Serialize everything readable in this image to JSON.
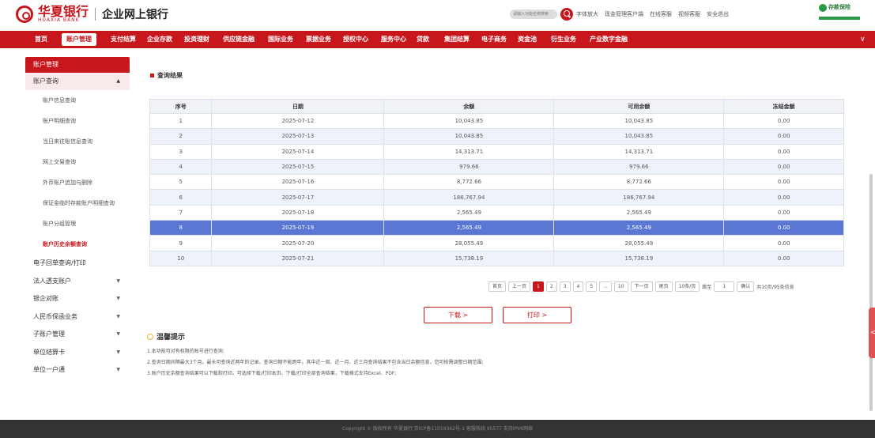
{
  "brand": {
    "name_cn": "华夏银行",
    "name_en": "HUAXIA BANK",
    "sub": "企业网上银行"
  },
  "header": {
    "search_placeholder": "请输入功能名称搜索",
    "links": [
      "字体放大",
      "现金管理客户端",
      "在线客服",
      "视频客服",
      "安全退出"
    ],
    "insurance": "存款保险"
  },
  "nav": {
    "items": [
      "首页",
      "账户管理",
      "支付结算",
      "企业存款",
      "投资理财",
      "供应链金融",
      "国际业务",
      "票据业务",
      "授权中心",
      "服务中心",
      "贷款",
      "集团结算",
      "电子商务",
      "资金池",
      "衍生业务",
      "产业数字金融"
    ],
    "active": 1
  },
  "sidebar": {
    "header": "账户管理",
    "group": "账户查询",
    "subitems": [
      "账户信息查询",
      "账户明细查询",
      "当日来往账信息查询",
      "网上交易查询",
      "外币账户追加与删除",
      "保证金临时存款账户明细查询",
      "账户分组管理",
      "账户历史余额查询"
    ],
    "active_sub": 7,
    "items": [
      {
        "label": "电子回单查询/打印",
        "expand": false
      },
      {
        "label": "法人透支账户",
        "expand": true
      },
      {
        "label": "银企对账",
        "expand": true
      },
      {
        "label": "人民币保函业务",
        "expand": true
      },
      {
        "label": "子账户管理",
        "expand": true
      },
      {
        "label": "单位结算卡",
        "expand": true
      },
      {
        "label": "单位一户通",
        "expand": true
      }
    ]
  },
  "main": {
    "section_title": "查询结果",
    "columns": [
      "序号",
      "日期",
      "余额",
      "可用余额",
      "冻结金额"
    ],
    "rows": [
      [
        "1",
        "2025-07-12",
        "10,043.85",
        "10,043.85",
        "0.00"
      ],
      [
        "2",
        "2025-07-13",
        "10,043.85",
        "10,043.85",
        "0.00"
      ],
      [
        "3",
        "2025-07-14",
        "14,313.71",
        "14,313.71",
        "0.00"
      ],
      [
        "4",
        "2025-07-15",
        "979.66",
        "979.66",
        "0.00"
      ],
      [
        "5",
        "2025-07-16",
        "8,772.66",
        "8,772.66",
        "0.00"
      ],
      [
        "6",
        "2025-07-17",
        "186,767.94",
        "186,767.94",
        "0.00"
      ],
      [
        "7",
        "2025-07-18",
        "2,565.49",
        "2,565.49",
        "0.00"
      ],
      [
        "8",
        "2025-07-19",
        "2,565.49",
        "2,565.49",
        "0.00"
      ],
      [
        "9",
        "2025-07-20",
        "28,055.49",
        "28,055.49",
        "0.00"
      ],
      [
        "10",
        "2025-07-21",
        "15,738.19",
        "15,738.19",
        "0.00"
      ]
    ],
    "selected_row": 8,
    "pager": {
      "first": "首页",
      "prev": "上一页",
      "pages": [
        "1",
        "2",
        "3",
        "4",
        "5",
        "...",
        "10"
      ],
      "next": "下一页",
      "last": "尾页",
      "size": "10条/页",
      "goto": "跳至",
      "goto_value": "1",
      "confirm": "确认",
      "total": "共10页/95条信息"
    },
    "buttons": {
      "download": "下载 >",
      "print": "打印 >"
    },
    "tips": {
      "title": "温馨提示",
      "lines": [
        "1.本功能可对有权限的账号进行查询;",
        "2.查询日期间隔最大3个月。最长可查询近两年的记录。查询日期不能跨年。其中近一周、近一月、近三月查询结果不包含当日余额信息，您可按需调整日期范围;",
        "3.账户历史余额查询结果可以下载和打印。可选择下载/打印本页、下载/打印全部查询结果，下载格式支持Excel、PDF;"
      ]
    }
  },
  "footer": "Copyright © 版权所有 华夏银行 京ICP备11019362号-1 客服热线 95577 支持IPV6网络",
  "side_tab": "<"
}
